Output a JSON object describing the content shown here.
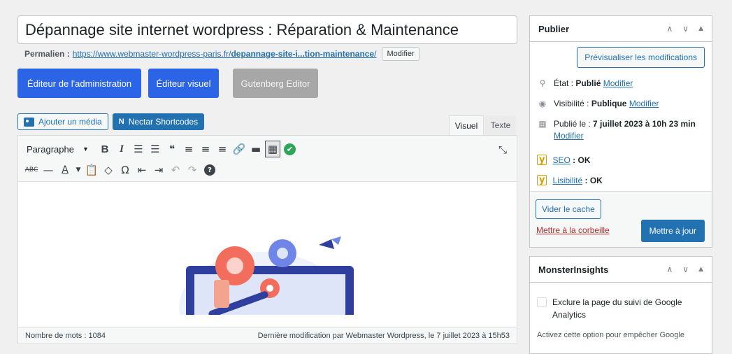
{
  "post": {
    "title": "Dépannage site internet wordpress : Réparation & Maintenance",
    "permalink_label": "Permalien :",
    "permalink_base": "https://www.webmaster-wordpress-paris.fr/",
    "permalink_slug": "depannage-site-i...tion-maintenance",
    "permalink_trailing": "/",
    "permalink_modify": "Modifier"
  },
  "editor_modes": {
    "admin": "Éditeur de l'administration",
    "visual": "Éditeur visuel",
    "gutenberg": "Gutenberg Editor"
  },
  "media": {
    "add_media": "Ajouter un média",
    "nectar": "Nectar Shortcodes",
    "nectar_glyph": "N"
  },
  "tabs": {
    "visual": "Visuel",
    "text": "Texte"
  },
  "toolbar": {
    "format": "Paragraphe",
    "dropdown_arrow": "▼",
    "bold": "B",
    "italic": "I",
    "bullet_list": "☰",
    "num_list": "☰",
    "quote": "❝",
    "align_left": "≡",
    "align_center": "≡",
    "align_right": "≡",
    "link": "🔗",
    "more": "▬",
    "kitchen": "▦",
    "check": "✔",
    "strike": "ABC",
    "hr": "—",
    "text_color": "A",
    "paste": "📋",
    "clear": "◇",
    "omega": "Ω",
    "outdent": "⇤",
    "indent": "⇥",
    "undo": "↶",
    "redo": "↷",
    "help": "?",
    "expand": "⤡"
  },
  "status": {
    "word_count": "Nombre de mots : 1084",
    "last_modified": "Dernière modification par Webmaster Wordpress, le 7 juillet 2023 à 15h53"
  },
  "publish": {
    "title": "Publier",
    "up": "∧",
    "down": "∨",
    "toggle": "▲",
    "preview": "Prévisualiser les modifications",
    "state_prefix": "État :",
    "state_value": "Publié",
    "visibility_prefix": "Visibilité :",
    "visibility_value": "Publique",
    "modify": "Modifier",
    "date_prefix": "Publié le :",
    "date_value": "7 juillet 2023 à 10h 23 min",
    "seo_label": "SEO",
    "seo_value": ": OK",
    "readability_label": "Lisibilité",
    "readability_value": ": OK",
    "clear_cache": "Vider le cache",
    "trash": "Mettre à la corbeille",
    "update": "Mettre à jour"
  },
  "monster": {
    "title": "MonsterInsights",
    "exclude_label": "Exclure la page du suivi de Google Analytics",
    "note": "Activez cette option pour empêcher Google"
  },
  "colors": {
    "primary": "#2271b1",
    "admin_blue": "#2c64e8",
    "disabled_gray": "#a7a7a7",
    "success_green": "#2fa55a",
    "danger_red": "#b32d2e",
    "yoast_yellow": "#d7a000"
  }
}
